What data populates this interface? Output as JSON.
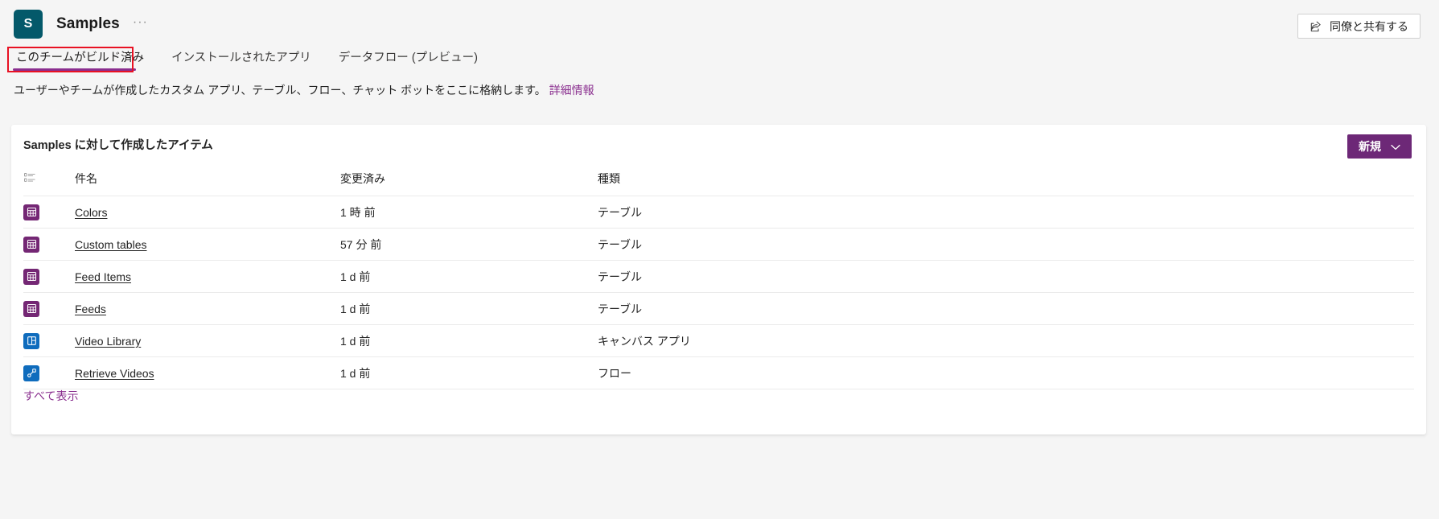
{
  "header": {
    "avatar_initial": "S",
    "title": "Samples",
    "more_label": "···",
    "share_button": "同僚と共有する",
    "share_icon": "share-icon"
  },
  "tabs": {
    "items": [
      {
        "label": "このチームがビルド済み",
        "active": true
      },
      {
        "label": "インストールされたアプリ",
        "active": false
      },
      {
        "label": "データフロー (プレビュー)",
        "active": false
      }
    ],
    "accent_color": "#8a2f8f",
    "highlight_color": "#e81123"
  },
  "description": {
    "text": "ユーザーやチームが作成したカスタム アプリ、テーブル、フロー、チャット ボットをここに格納します。 ",
    "link_text": "詳細情報"
  },
  "card": {
    "title": "Samples に対して作成したアイテム",
    "new_button": "新規",
    "new_button_color": "#6d2877",
    "show_all": "すべて表示",
    "columns": {
      "icon": "sort-list-icon",
      "name": "件名",
      "modified": "変更済み",
      "type": "種類"
    },
    "rows": [
      {
        "icon": "table-icon",
        "kind": "table-kind",
        "name": "Colors",
        "modified": "1 時 前",
        "type": "テーブル"
      },
      {
        "icon": "table-icon",
        "kind": "table-kind",
        "name": "Custom tables",
        "modified": "57 分 前",
        "type": "テーブル"
      },
      {
        "icon": "table-icon",
        "kind": "table-kind",
        "name": "Feed Items",
        "modified": "1 d 前",
        "type": "テーブル"
      },
      {
        "icon": "table-icon",
        "kind": "table-kind",
        "name": "Feeds",
        "modified": "1 d 前",
        "type": "テーブル"
      },
      {
        "icon": "canvas-app-icon",
        "kind": "app-kind",
        "name": "Video Library",
        "modified": "1 d 前",
        "type": "キャンバス アプリ"
      },
      {
        "icon": "flow-icon",
        "kind": "flow-kind",
        "name": "Retrieve Videos",
        "modified": "1 d 前",
        "type": "フロー"
      }
    ]
  }
}
